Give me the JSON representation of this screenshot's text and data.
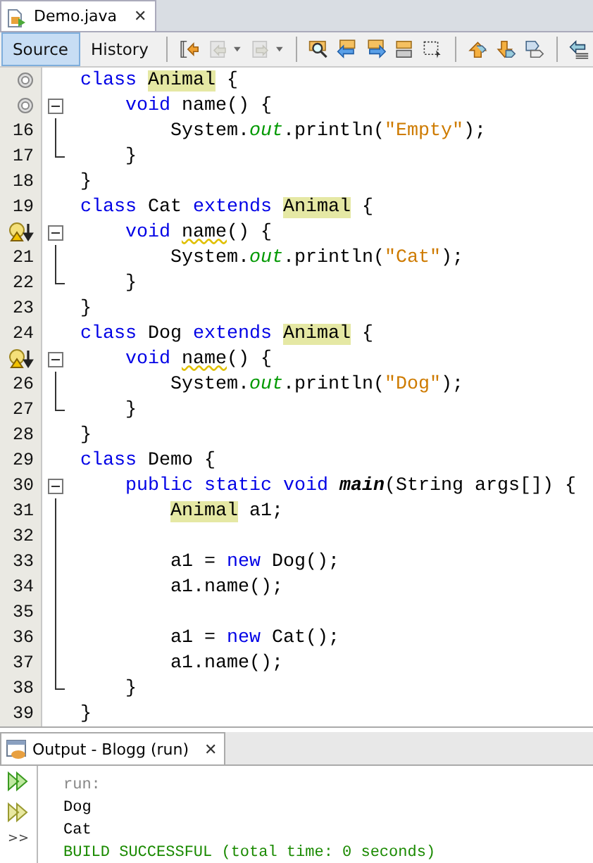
{
  "editor_tab": {
    "title": "Demo.java",
    "close": "✕"
  },
  "toolbar": {
    "views": [
      {
        "label": "Source",
        "selected": true
      },
      {
        "label": "History",
        "selected": false
      }
    ],
    "tools": [
      {
        "kind": "last-edit",
        "disabled": false,
        "separator_before": true
      },
      {
        "kind": "back",
        "disabled": true,
        "dropdown": true
      },
      {
        "kind": "forward",
        "disabled": true,
        "dropdown": true
      },
      {
        "kind": "find",
        "disabled": false,
        "separator_before": true
      },
      {
        "kind": "find-prev",
        "disabled": false
      },
      {
        "kind": "find-next",
        "disabled": false
      },
      {
        "kind": "highlight",
        "disabled": false
      },
      {
        "kind": "rect-select",
        "disabled": false
      },
      {
        "kind": "prev-bookmark",
        "disabled": false,
        "separator_before": true
      },
      {
        "kind": "next-bookmark",
        "disabled": false
      },
      {
        "kind": "toggle-bookmark",
        "disabled": false
      },
      {
        "kind": "shift-left",
        "disabled": false,
        "separator_before": true
      }
    ]
  },
  "lines": [
    {
      "marker": {
        "kind": "override"
      },
      "tokens": [
        {
          "text": "class ",
          "kind": "keyword"
        },
        {
          "text": "Animal",
          "kind": "highlight"
        },
        {
          "text": " {",
          "kind": "plain"
        }
      ]
    },
    {
      "marker": {
        "kind": "override"
      },
      "fold": {
        "kind": "collapse"
      },
      "tokens": [
        {
          "text": "    void",
          "kind": "keyword"
        },
        {
          "text": " name() {",
          "kind": "plain"
        }
      ]
    },
    {
      "number": "16",
      "fold": {
        "kind": "line"
      },
      "tokens": [
        {
          "text": "        System.",
          "kind": "plain"
        },
        {
          "text": "out",
          "kind": "field"
        },
        {
          "text": ".println(",
          "kind": "plain"
        },
        {
          "text": "\"Empty\"",
          "kind": "string"
        },
        {
          "text": ");",
          "kind": "plain"
        }
      ]
    },
    {
      "number": "17",
      "fold": {
        "kind": "end"
      },
      "tokens": [
        {
          "text": "    }",
          "kind": "plain"
        }
      ]
    },
    {
      "number": "18",
      "tokens": [
        {
          "text": "}",
          "kind": "plain"
        }
      ]
    },
    {
      "number": "19",
      "tokens": [
        {
          "text": "class",
          "kind": "keyword"
        },
        {
          "text": " Cat ",
          "kind": "plain"
        },
        {
          "text": "extends ",
          "kind": "keyword"
        },
        {
          "text": "Animal",
          "kind": "highlight"
        },
        {
          "text": " {",
          "kind": "plain"
        }
      ]
    },
    {
      "marker": {
        "kind": "warning"
      },
      "fold": {
        "kind": "collapse"
      },
      "tokens": [
        {
          "text": "    void ",
          "kind": "keyword"
        },
        {
          "text": "name",
          "kind": "warning"
        },
        {
          "text": "() {",
          "kind": "plain"
        }
      ]
    },
    {
      "number": "21",
      "fold": {
        "kind": "line"
      },
      "tokens": [
        {
          "text": "        System.",
          "kind": "plain"
        },
        {
          "text": "out",
          "kind": "field"
        },
        {
          "text": ".println(",
          "kind": "plain"
        },
        {
          "text": "\"Cat\"",
          "kind": "string"
        },
        {
          "text": ");",
          "kind": "plain"
        }
      ]
    },
    {
      "number": "22",
      "fold": {
        "kind": "end"
      },
      "tokens": [
        {
          "text": "    }",
          "kind": "plain"
        }
      ]
    },
    {
      "number": "23",
      "tokens": [
        {
          "text": "}",
          "kind": "plain"
        }
      ]
    },
    {
      "number": "24",
      "tokens": [
        {
          "text": "class",
          "kind": "keyword"
        },
        {
          "text": " Dog ",
          "kind": "plain"
        },
        {
          "text": "extends ",
          "kind": "keyword"
        },
        {
          "text": "Animal",
          "kind": "highlight"
        },
        {
          "text": " {",
          "kind": "plain"
        }
      ]
    },
    {
      "marker": {
        "kind": "warning"
      },
      "fold": {
        "kind": "collapse"
      },
      "tokens": [
        {
          "text": "    void ",
          "kind": "keyword"
        },
        {
          "text": "name",
          "kind": "warning"
        },
        {
          "text": "() {",
          "kind": "plain"
        }
      ]
    },
    {
      "number": "26",
      "fold": {
        "kind": "line"
      },
      "tokens": [
        {
          "text": "        System.",
          "kind": "plain"
        },
        {
          "text": "out",
          "kind": "field"
        },
        {
          "text": ".println(",
          "kind": "plain"
        },
        {
          "text": "\"Dog\"",
          "kind": "string"
        },
        {
          "text": ");",
          "kind": "plain"
        }
      ]
    },
    {
      "number": "27",
      "fold": {
        "kind": "end"
      },
      "tokens": [
        {
          "text": "    }",
          "kind": "plain"
        }
      ]
    },
    {
      "number": "28",
      "tokens": [
        {
          "text": "}",
          "kind": "plain"
        }
      ]
    },
    {
      "number": "29",
      "tokens": [
        {
          "text": "class",
          "kind": "keyword"
        },
        {
          "text": " Demo {",
          "kind": "plain"
        }
      ]
    },
    {
      "number": "30",
      "fold": {
        "kind": "collapse"
      },
      "tokens": [
        {
          "text": "    public static void ",
          "kind": "keyword"
        },
        {
          "text": "main",
          "kind": "method"
        },
        {
          "text": "(String args[]) {",
          "kind": "plain"
        }
      ]
    },
    {
      "number": "31",
      "fold": {
        "kind": "line"
      },
      "tokens": [
        {
          "text": "Animal",
          "kind": "highlight"
        },
        {
          "text": " a1;",
          "kind": "plain"
        }
      ],
      "kind": "body"
    },
    {
      "number": "32",
      "fold": {
        "kind": "line"
      }
    },
    {
      "number": "33",
      "fold": {
        "kind": "line"
      },
      "tokens": [
        {
          "text": "        a1 = ",
          "kind": "plain"
        },
        {
          "text": "new",
          "kind": "keyword"
        },
        {
          "text": " Dog();",
          "kind": "plain"
        }
      ]
    },
    {
      "number": "34",
      "fold": {
        "kind": "line"
      },
      "tokens": [
        {
          "text": "        a1.name();",
          "kind": "plain"
        }
      ]
    },
    {
      "number": "35",
      "fold": {
        "kind": "line"
      }
    },
    {
      "number": "36",
      "fold": {
        "kind": "line"
      },
      "tokens": [
        {
          "text": "        a1 = ",
          "kind": "plain"
        },
        {
          "text": "new",
          "kind": "keyword"
        },
        {
          "text": " Cat();",
          "kind": "plain"
        }
      ]
    },
    {
      "number": "37",
      "fold": {
        "kind": "line"
      },
      "tokens": [
        {
          "text": "        a1.name();",
          "kind": "plain"
        }
      ]
    },
    {
      "number": "38",
      "fold": {
        "kind": "end"
      },
      "tokens": [
        {
          "text": "    }",
          "kind": "plain"
        }
      ]
    },
    {
      "number": "39",
      "tokens": [
        {
          "text": "}",
          "kind": "plain"
        }
      ]
    }
  ],
  "output": {
    "title": "Output - Blogg (run)",
    "close": "✕",
    "more": ">>",
    "lines": [
      {
        "text": "run:",
        "kind": "info"
      },
      {
        "text": "Dog",
        "kind": "out"
      },
      {
        "text": "Cat",
        "kind": "out"
      },
      {
        "text": "BUILD SUCCESSFUL (total time: 0 seconds)",
        "kind": "success"
      }
    ]
  }
}
